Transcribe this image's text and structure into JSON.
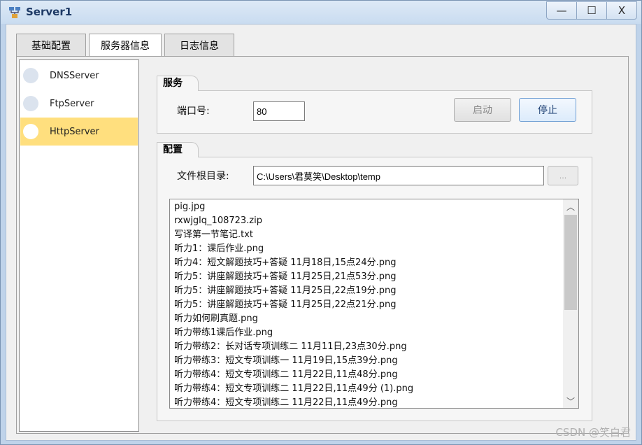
{
  "window": {
    "title": "Server1",
    "minimize_label": "—",
    "maximize_label": "☐",
    "close_label": "X"
  },
  "tabs": [
    {
      "label": "基础配置",
      "active": false
    },
    {
      "label": "服务器信息",
      "active": true
    },
    {
      "label": "日志信息",
      "active": false
    }
  ],
  "sidebar": {
    "items": [
      {
        "label": "DNSServer",
        "selected": false
      },
      {
        "label": "FtpServer",
        "selected": false
      },
      {
        "label": "HttpServer",
        "selected": true
      }
    ]
  },
  "service": {
    "group_title": "服务",
    "port_label": "端口号:",
    "port_value": "80",
    "start_label": "启动",
    "stop_label": "停止"
  },
  "config": {
    "group_title": "配置",
    "root_label": "文件根目录:",
    "root_value": "C:\\Users\\君莫笑\\Desktop\\temp",
    "browse_label": "...",
    "files": [
      "pig.jpg",
      "rxwjglq_108723.zip",
      "写译第一节笔记.txt",
      "听力1：课后作业.png",
      "听力4：短文解题技巧+答疑 11月18日,15点24分.png",
      "听力5：讲座解题技巧+答疑 11月25日,21点53分.png",
      "听力5：讲座解题技巧+答疑 11月25日,22点19分.png",
      "听力5：讲座解题技巧+答疑 11月25日,22点21分.png",
      "听力如何刷真题.png",
      "听力带练1课后作业.png",
      "听力带练2：长对话专项训练二 11月11日,23点30分.png",
      "听力带练3：短文专项训练一 11月19日,15点39分.png",
      "听力带练4：短文专项训练二 11月22日,11点48分.png",
      "听力带练4：短文专项训练二 11月22日,11点49分 (1).png",
      "听力带练4：短文专项训练二 11月22日,11点49分.png"
    ]
  },
  "watermark": "CSDN @笑白君",
  "colors": {
    "selected_item": "#ffdf7e",
    "title_text": "#1e3a66"
  }
}
